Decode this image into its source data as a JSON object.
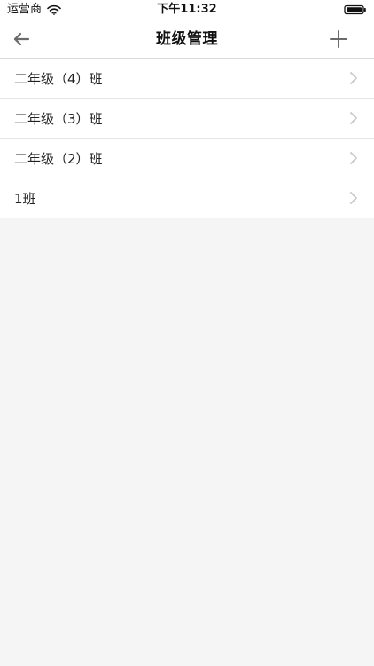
{
  "status_bar": {
    "carrier": "运营商",
    "time": "下午11:32",
    "icons": {
      "wifi": "wifi-icon",
      "battery": "battery-icon"
    }
  },
  "nav": {
    "title": "班级管理",
    "icons": {
      "back": "back-arrow-icon",
      "add": "plus-icon"
    }
  },
  "classes": [
    {
      "name": "二年级（4）班"
    },
    {
      "name": "二年级（3）班"
    },
    {
      "name": "二年级（2）班"
    },
    {
      "name": "1班"
    }
  ],
  "colors": {
    "background": "#f5f5f5",
    "surface": "#ffffff",
    "divider": "#e5e5e5",
    "text": "#222222",
    "icon": "#6b6b6b",
    "chevron": "#c7c7cc"
  }
}
